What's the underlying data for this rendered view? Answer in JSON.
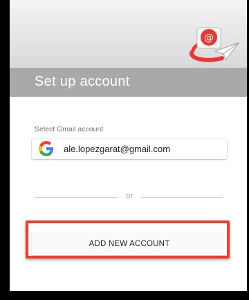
{
  "header": {
    "title": "Set up account",
    "logo_icon": "email-app-logo-icon"
  },
  "account_section": {
    "select_label": "Select Gmail account",
    "accounts": [
      {
        "email": "ale.lopezgarat@gmail.com",
        "icon": "google-g-icon"
      }
    ]
  },
  "divider": {
    "text": "or"
  },
  "actions": {
    "add_new_account_label": "ADD NEW ACCOUNT"
  },
  "colors": {
    "title_bar": "#a9a9a9",
    "highlight": "#f23c2a",
    "google_blue": "#4285F4",
    "google_red": "#EA4335",
    "google_yellow": "#FBBC05",
    "google_green": "#34A853"
  }
}
